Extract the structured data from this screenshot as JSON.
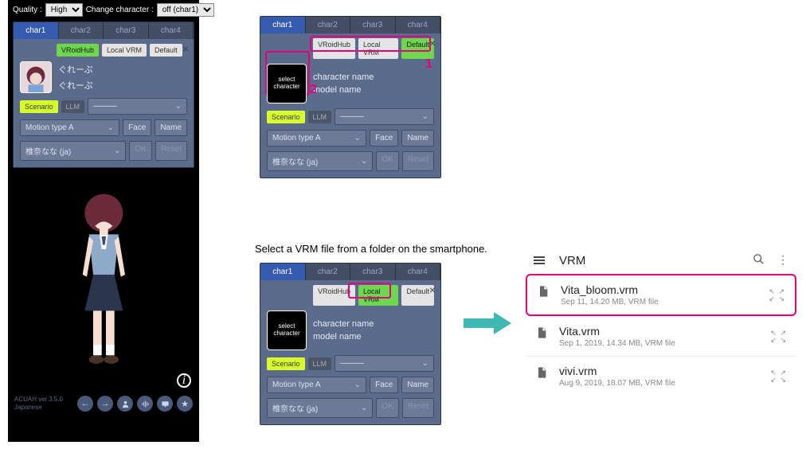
{
  "topbar": {
    "quality_label": "Quality :",
    "quality_value": "High",
    "change_char_label": "Change character :",
    "change_char_value": "off (char1)"
  },
  "tabs": [
    "char1",
    "char2",
    "char3",
    "char4"
  ],
  "pills": {
    "vroidhub": "VRoidHub",
    "localvrm": "Local VRM",
    "default": "Default"
  },
  "name1": "ぐれーぷ",
  "name2": "ぐれーぷ",
  "placeholder_char_name": "character name",
  "placeholder_model_name": "model name",
  "placeholder_select_char": "select character",
  "scenario": "Scenario",
  "llm": "LLM",
  "dash": "———",
  "motion": "Motion type A",
  "voice": "椎奈なな (ja)",
  "btn_face": "Face",
  "btn_name": "Name",
  "btn_ok": "OK",
  "btn_reset": "Reset",
  "annot1": "1",
  "annot2": "2",
  "instruction": "Select a VRM file from a folder on the smartphone.",
  "version_line1": "ACUAH ver.3.5.0",
  "version_line2": "Japanese",
  "filepicker": {
    "title": "VRM",
    "items": [
      {
        "name": "Vita_bloom.vrm",
        "sub": "Sep 11, 14.20 MB, VRM file"
      },
      {
        "name": "Vita.vrm",
        "sub": "Sep 1, 2019, 14.34 MB, VRM file"
      },
      {
        "name": "vivi.vrm",
        "sub": "Aug 9, 2019, 18.07 MB, VRM file"
      }
    ]
  }
}
